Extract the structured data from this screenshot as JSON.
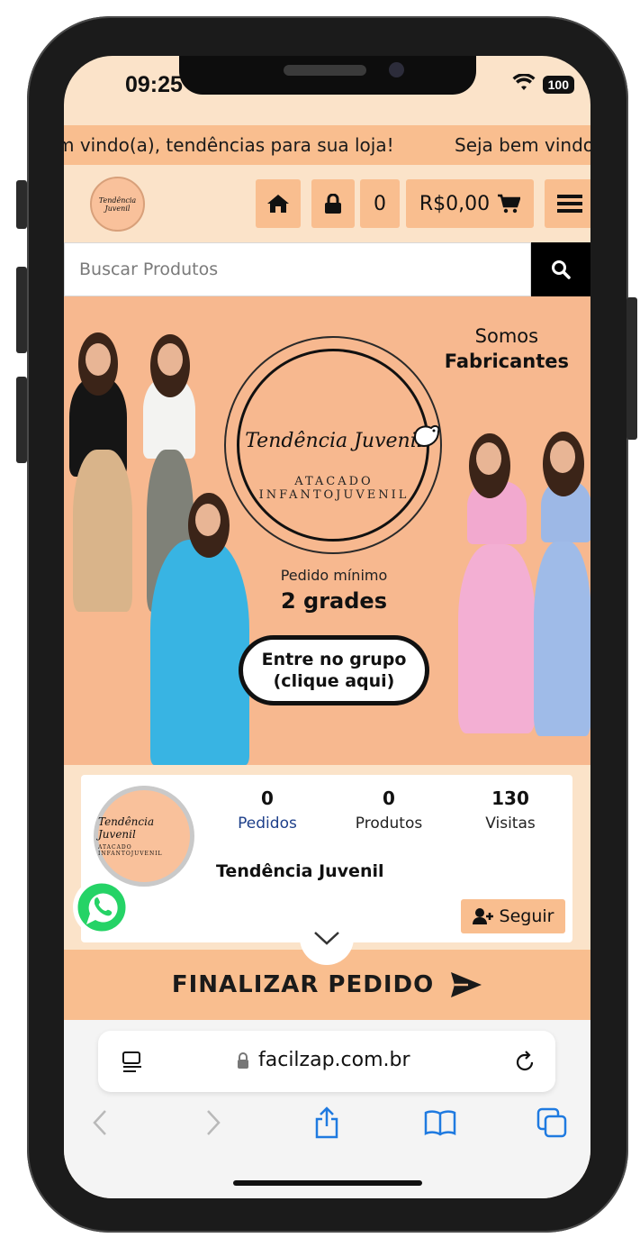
{
  "status_bar": {
    "time": "09:25",
    "battery": "100"
  },
  "ticker": {
    "message1": "m vindo(a), tendências para sua loja!",
    "message2": "Seja bem vindo"
  },
  "header": {
    "cart_count": "0",
    "cart_total": "R$0,00",
    "icons": [
      "home-icon",
      "lock-icon",
      "cart-icon",
      "menu-icon"
    ]
  },
  "search": {
    "placeholder": "Buscar Produtos"
  },
  "banner": {
    "somos": "Somos",
    "fabricantes": "Fabricantes",
    "brand_name": "Tendência Juvenil",
    "brand_sub": "ATACADO INFANTOJUVENIL",
    "pedido_minimo": "Pedido mínimo",
    "grades": "2 grades",
    "cta_line1": "Entre no grupo",
    "cta_line2": "(clique aqui)"
  },
  "profile": {
    "name": "Tendência Juvenil",
    "logo_text": "Tendência Juvenil",
    "logo_sub": "ATACADO INFANTOJUVENIL",
    "stats": [
      {
        "num": "0",
        "label": "Pedidos"
      },
      {
        "num": "0",
        "label": "Produtos"
      },
      {
        "num": "130",
        "label": "Visitas"
      }
    ],
    "follow_label": "Seguir"
  },
  "checkout": {
    "label": "FINALIZAR PEDIDO"
  },
  "browser": {
    "url": "facilzap.com.br"
  },
  "colors": {
    "accent": "#f9be8f",
    "background": "#fbe3c9",
    "banner": "#f7b88f",
    "search_button": "#000000",
    "link_blue": "#1d3f8a"
  }
}
